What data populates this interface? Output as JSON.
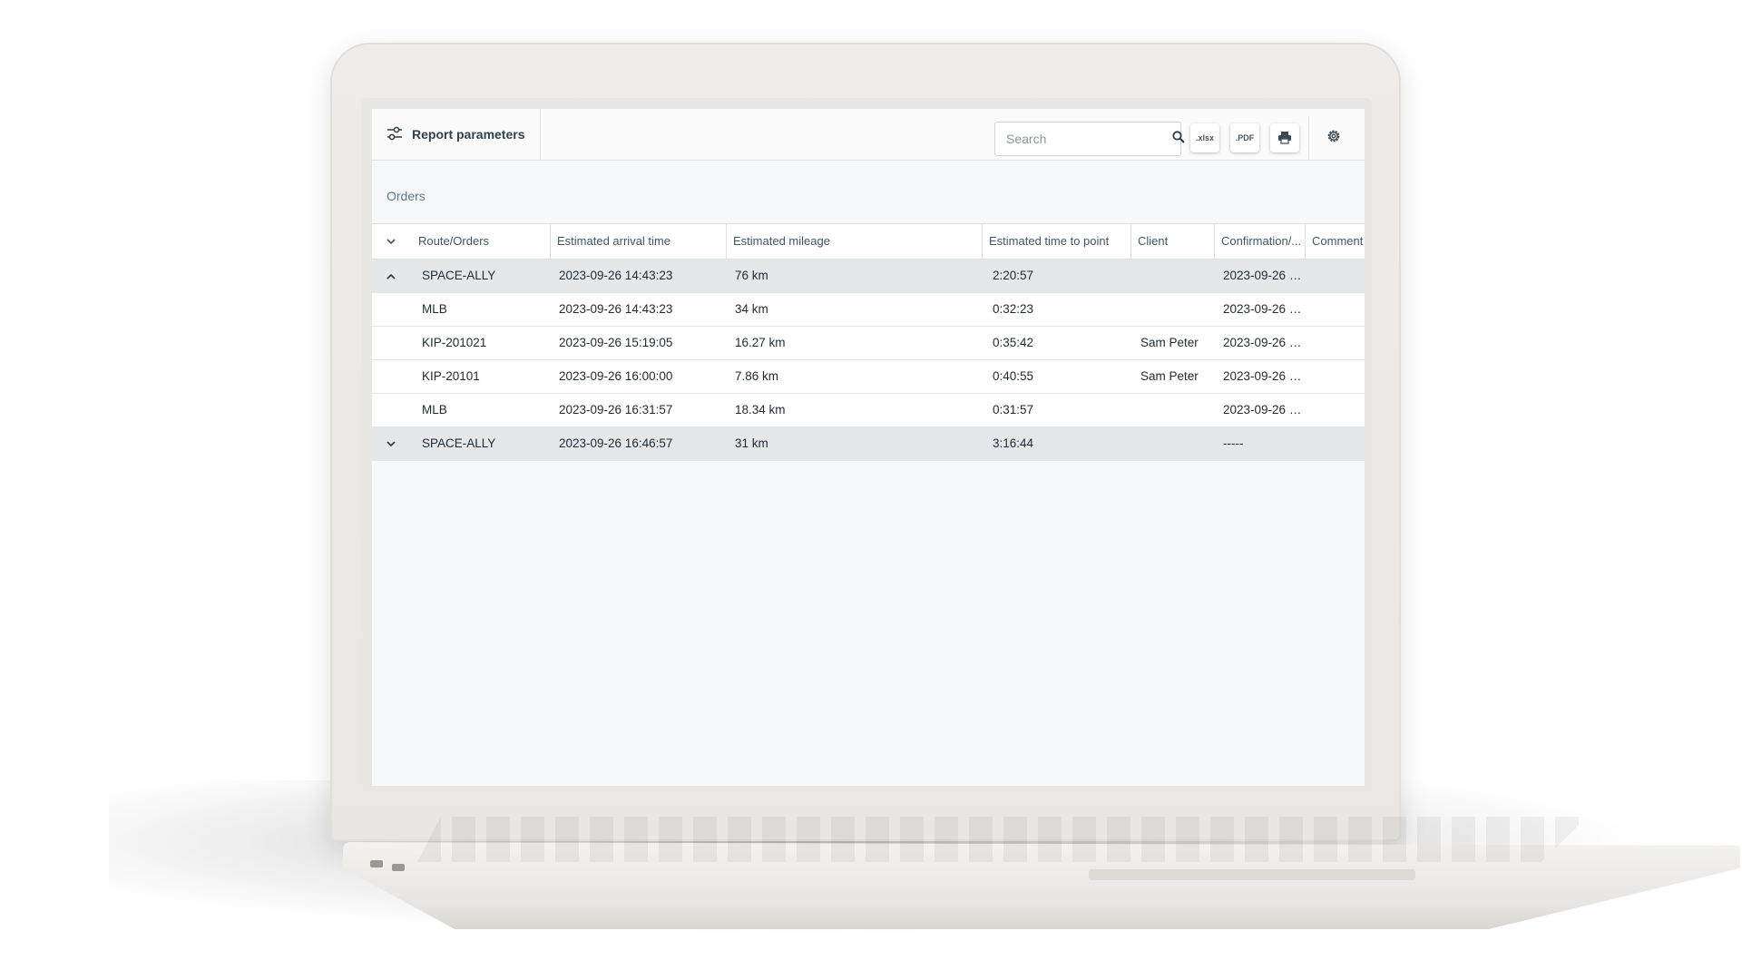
{
  "toolbar": {
    "report_params_label": "Report parameters",
    "search_placeholder": "Search",
    "xlsx_label": ".xlsx",
    "pdf_label": ".PDF"
  },
  "section_title": "Orders",
  "table": {
    "headers": [
      "Route/Orders",
      "Estimated arrival time",
      "Estimated mileage",
      "Estimated time to point",
      "Client",
      "Confirmation/...",
      "Comment"
    ],
    "rows": [
      {
        "type": "group",
        "expanded": true,
        "route": "SPACE-ALLY",
        "arrival": "2023-09-26 14:43:23",
        "mileage": "76 km",
        "time": "2:20:57",
        "client": "",
        "confirm": "2023-09-26 1...",
        "comment": ""
      },
      {
        "type": "order",
        "route": "MLB",
        "arrival": "2023-09-26 14:43:23",
        "mileage": "34 km",
        "time": "0:32:23",
        "client": "",
        "confirm": "2023-09-26 1...",
        "comment": ""
      },
      {
        "type": "order",
        "route": "KIP-201021",
        "arrival": "2023-09-26 15:19:05",
        "mileage": "16.27 km",
        "time": "0:35:42",
        "client": "Sam Peter",
        "confirm": "2023-09-26 1...",
        "comment": ""
      },
      {
        "type": "order",
        "route": "KIP-20101",
        "arrival": "2023-09-26 16:00:00",
        "mileage": "7.86 km",
        "time": "0:40:55",
        "client": "Sam Peter",
        "confirm": "2023-09-26 1...",
        "comment": ""
      },
      {
        "type": "order",
        "route": "MLB",
        "arrival": "2023-09-26 16:31:57",
        "mileage": "18.34 km",
        "time": "0:31:57",
        "client": "",
        "confirm": "2023-09-26 1...",
        "comment": ""
      },
      {
        "type": "group",
        "expanded": false,
        "route": "SPACE-ALLY",
        "arrival": "2023-09-26 16:46:57",
        "mileage": "31 km",
        "time": "3:16:44",
        "client": "",
        "confirm": "-----",
        "comment": ""
      }
    ]
  },
  "icons": {
    "report_params": "sliders-icon",
    "search": "search-icon",
    "print": "printer-icon",
    "settings": "gear-icon",
    "collapse_all": "chevron-down-icon"
  },
  "colors": {
    "group_row_bg": "#e5e7e9",
    "header_text": "#3f5566",
    "section_title": "#5b7d8c",
    "laptop_body": "#efedea"
  }
}
